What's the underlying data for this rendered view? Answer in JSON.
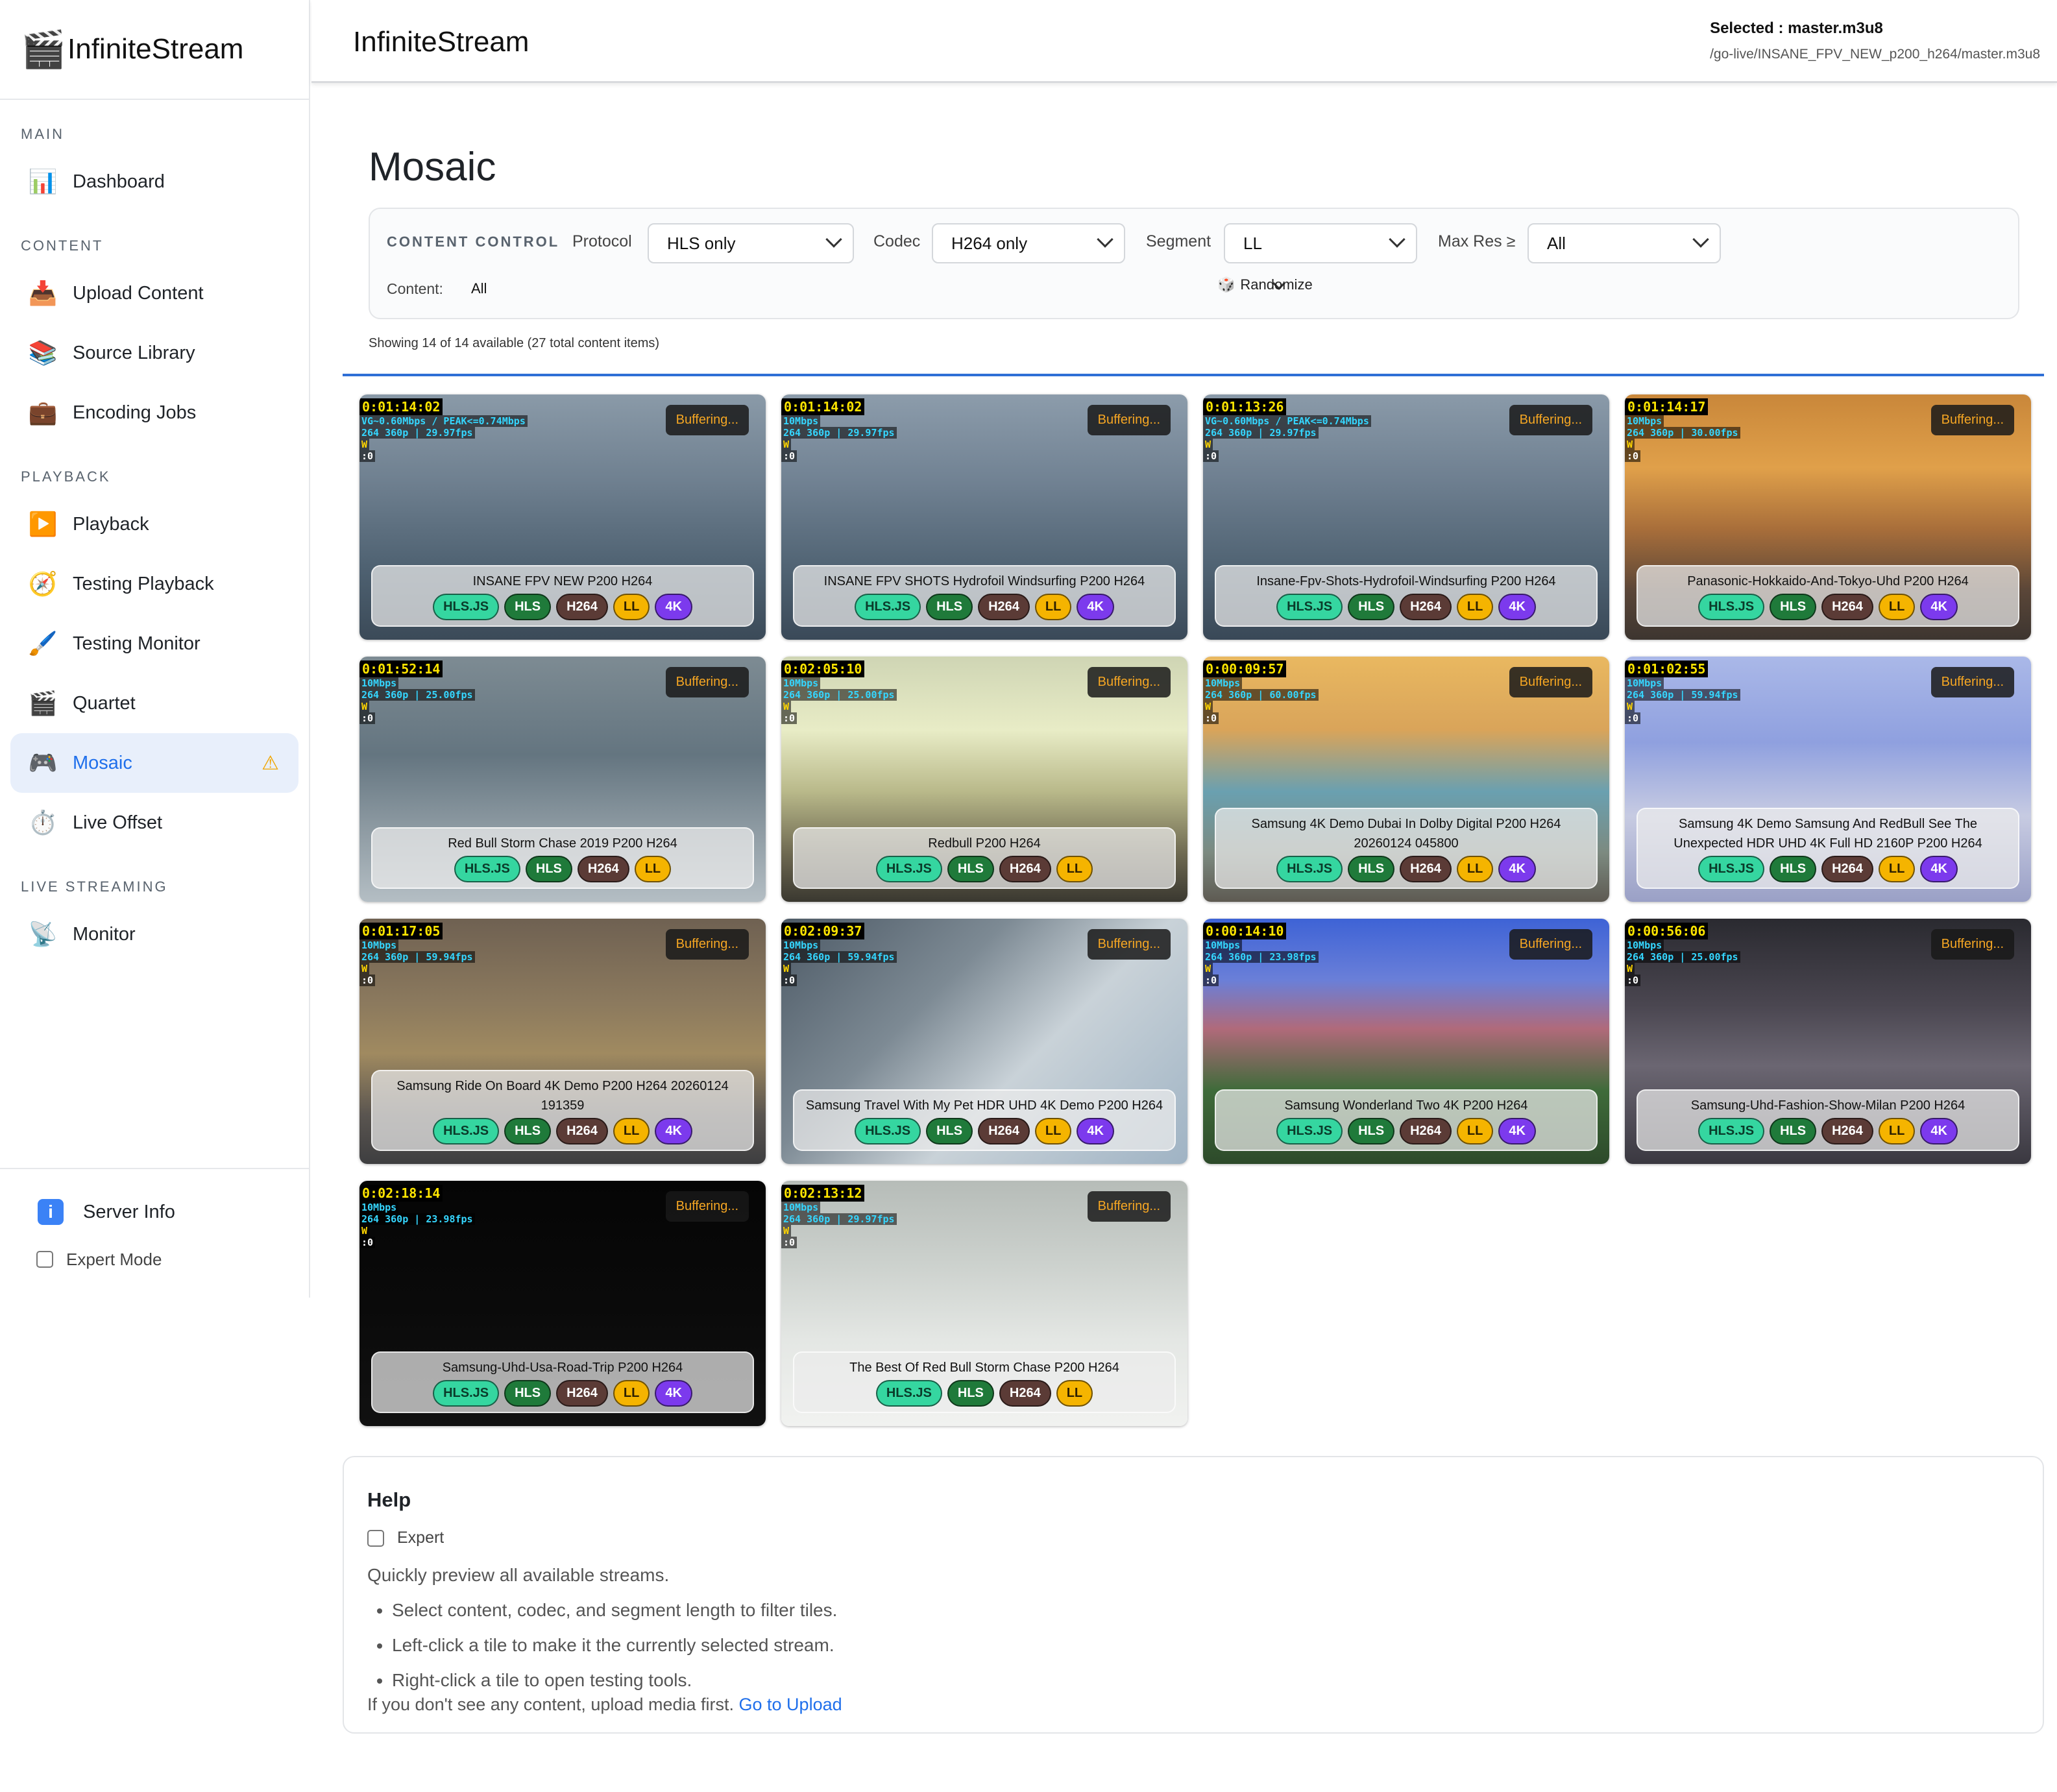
{
  "app": {
    "name": "InfiniteStream",
    "logo_icon": "clapperboard-icon"
  },
  "sidebar": {
    "sections": [
      {
        "label": "MAIN",
        "items": [
          {
            "label": "Dashboard",
            "icon": "bar-chart-icon"
          }
        ]
      },
      {
        "label": "CONTENT",
        "items": [
          {
            "label": "Upload Content",
            "icon": "upload-tray-icon"
          },
          {
            "label": "Source Library",
            "icon": "books-icon"
          },
          {
            "label": "Encoding Jobs",
            "icon": "briefcase-icon"
          }
        ]
      },
      {
        "label": "PLAYBACK",
        "items": [
          {
            "label": "Playback",
            "icon": "play-button-icon"
          },
          {
            "label": "Testing Playback",
            "icon": "compass-icon"
          },
          {
            "label": "Testing Monitor",
            "icon": "brush-icon"
          },
          {
            "label": "Quartet",
            "icon": "clapperboard-icon"
          },
          {
            "label": "Mosaic",
            "icon": "game-controller-icon",
            "active": true,
            "warning": "⚠"
          },
          {
            "label": "Live Offset",
            "icon": "stopwatch-icon"
          }
        ]
      },
      {
        "label": "LIVE STREAMING",
        "items": [
          {
            "label": "Monitor",
            "icon": "satellite-icon"
          }
        ]
      }
    ],
    "server_info": "Server Info",
    "expert_mode": "Expert Mode"
  },
  "header": {
    "title": "InfiniteStream",
    "selected_label": "Selected : master.m3u8",
    "selected_path": "/go-live/INSANE_FPV_NEW_p200_h264/master.m3u8"
  },
  "main": {
    "title": "Mosaic",
    "controls": {
      "section_label": "CONTENT CONTROL",
      "protocol_label": "Protocol",
      "protocol_value": "HLS only",
      "codec_label": "Codec",
      "codec_value": "H264 only",
      "segment_label": "Segment",
      "segment_value": "LL",
      "maxres_label": "Max Res ≥",
      "maxres_value": "All",
      "content_label": "Content:",
      "content_value": "All",
      "randomize_label": "Randomize"
    },
    "showing": "Showing 14 of 14 available (27 total content items)",
    "buffering_label": "Buffering...",
    "tiles": [
      {
        "name": "INSANE FPV NEW P200 H264",
        "timecode": "0:01:14:02",
        "line1": "VG~0.60Mbps / PEAK<=0.74Mbps",
        "line2": "264 360p | 29.97fps",
        "badges": [
          "HLS.JS",
          "HLS",
          "H264",
          "LL",
          "4K"
        ],
        "bg": "linear-gradient(180deg,#8a9aa8 0%,#6f8090 35%,#4f6272 70%,#3b4a58 100%)"
      },
      {
        "name": "INSANE FPV SHOTS Hydrofoil Windsurfing P200 H264",
        "timecode": "0:01:14:02",
        "line1": "10Mbps",
        "line2": "264 360p | 29.97fps",
        "badges": [
          "HLS.JS",
          "HLS",
          "H264",
          "LL",
          "4K"
        ],
        "bg": "linear-gradient(180deg,#8c9cab 0%,#718293 35%,#516474 70%,#3a4958 100%)"
      },
      {
        "name": "Insane-Fpv-Shots-Hydrofoil-Windsurfing P200 H264",
        "timecode": "0:01:13:26",
        "line1": "VG~0.60Mbps / PEAK<=0.74Mbps",
        "line2": "264 360p | 29.97fps",
        "badges": [
          "HLS.JS",
          "HLS",
          "H264",
          "LL",
          "4K"
        ],
        "bg": "linear-gradient(180deg,#8a9aa9 0%,#6e7f90 35%,#506373 70%,#394857 100%)"
      },
      {
        "name": "Panasonic-Hokkaido-And-Tokyo-Uhd P200 H264",
        "timecode": "0:01:14:17",
        "line1": "10Mbps",
        "line2": "264 360p | 30.00fps",
        "badges": [
          "HLS.JS",
          "HLS",
          "H264",
          "LL",
          "4K"
        ],
        "bg": "linear-gradient(180deg,#c9873a 0%,#e0a04a 30%,#a86e3a 55%,#5a4638 80%,#3d3530 100%)"
      },
      {
        "name": "Red Bull Storm Chase 2019 P200 H264",
        "timecode": "0:01:52:14",
        "line1": "10Mbps",
        "line2": "264 360p | 25.00fps",
        "badges": [
          "HLS.JS",
          "HLS",
          "H264",
          "LL"
        ],
        "bg": "linear-gradient(180deg,#7d8b93 0%,#647580 40%,#8d9aa2 70%,#b4bec4 100%)"
      },
      {
        "name": "Redbull P200 H264",
        "timecode": "0:02:05:10",
        "line1": "10Mbps",
        "line2": "264 360p | 25.00fps",
        "badges": [
          "HLS.JS",
          "HLS",
          "H264",
          "LL"
        ],
        "bg": "linear-gradient(180deg,#cfd5b4 0%,#e8ecc6 30%,#b9b98a 55%,#6f6a52 80%,#3a3830 100%)"
      },
      {
        "name": "Samsung 4K Demo Dubai In Dolby Digital P200 H264 20260124 045800",
        "timecode": "0:00:09:57",
        "line1": "10Mbps",
        "line2": "264 360p | 60.00fps",
        "badges": [
          "HLS.JS",
          "HLS",
          "H264",
          "LL",
          "4K"
        ],
        "bg": "linear-gradient(180deg,#e9b860 0%,#d9a45a 30%,#6aa0b0 55%,#7c8a80 80%,#5e5a52 100%)"
      },
      {
        "name": "Samsung 4K Demo Samsung And RedBull See The Unexpected HDR UHD 4K Full HD 2160P P200 H264",
        "timecode": "0:01:02:55",
        "line1": "10Mbps",
        "line2": "264 360p | 59.94fps",
        "badges": [
          "HLS.JS",
          "HLS",
          "H264",
          "LL",
          "4K"
        ],
        "bg": "linear-gradient(180deg,#aab8e8 0%,#8fa0df 35%,#c7cbe2 65%,#9aa0c6 100%)"
      },
      {
        "name": "Samsung Ride On Board 4K Demo P200 H264 20260124 191359",
        "timecode": "0:01:17:05",
        "line1": "10Mbps",
        "line2": "264 360p | 59.94fps",
        "badges": [
          "HLS.JS",
          "HLS",
          "H264",
          "LL",
          "4K"
        ],
        "bg": "linear-gradient(180deg,#6f6152 0%,#8c7a5e 35%,#a08a60 55%,#5a5550 80%,#3e3e40 100%)"
      },
      {
        "name": "Samsung Travel With My Pet HDR UHD 4K Demo P200 H264",
        "timecode": "0:02:09:37",
        "line1": "10Mbps",
        "line2": "264 360p | 59.94fps",
        "badges": [
          "HLS.JS",
          "HLS",
          "H264",
          "LL",
          "4K"
        ],
        "bg": "linear-gradient(135deg,#4d5a66 0%,#7d8a94 35%,#c9d2d8 60%,#9fb3c4 100%)"
      },
      {
        "name": "Samsung Wonderland Two 4K P200 H264",
        "timecode": "0:00:14:10",
        "line1": "10Mbps",
        "line2": "264 360p | 23.98fps",
        "badges": [
          "HLS.JS",
          "HLS",
          "H264",
          "LL",
          "4K"
        ],
        "bg": "linear-gradient(180deg,#3e63d6 0%,#6a7fd8 25%,#b06a7a 45%,#3f6b3a 70%,#2d4a2a 100%)"
      },
      {
        "name": "Samsung-Uhd-Fashion-Show-Milan P200 H264",
        "timecode": "0:00:56:06",
        "line1": "10Mbps",
        "line2": "264 360p | 25.00fps",
        "badges": [
          "HLS.JS",
          "HLS",
          "H264",
          "LL",
          "4K"
        ],
        "bg": "linear-gradient(180deg,#2a2a30 0%,#4a4650 35%,#6b6672 60%,#3a3840 100%)"
      },
      {
        "name": "Samsung-Uhd-Usa-Road-Trip P200 H264",
        "timecode": "0:02:18:14",
        "line1": "10Mbps",
        "line2": "264 360p | 23.98fps",
        "badges": [
          "HLS.JS",
          "HLS",
          "H264",
          "LL",
          "4K"
        ],
        "bg": "linear-gradient(180deg,#050505 0%,#0a0a0a 50%,#111111 100%)"
      },
      {
        "name": "The Best Of Red Bull Storm Chase P200 H264",
        "timecode": "0:02:13:12",
        "line1": "10Mbps",
        "line2": "264 360p | 29.97fps",
        "badges": [
          "HLS.JS",
          "HLS",
          "H264",
          "LL"
        ],
        "bg": "linear-gradient(180deg,#b6bcb8 0%,#cdd2ce 35%,#e4e7e4 65%,#f1f2f0 100%)"
      }
    ]
  },
  "help": {
    "title": "Help",
    "expert_label": "Expert",
    "intro": "Quickly preview all available streams.",
    "bullets": [
      "Select content, codec, and segment length to filter tiles.",
      "Left-click a tile to make it the currently selected stream.",
      "Right-click a tile to open testing tools."
    ],
    "footer_text": "If you don't see any content, upload media first.",
    "footer_link": "Go to Upload"
  },
  "colors": {
    "accent": "#1f6feb",
    "buffering": "#f5a623",
    "divider": "#2f6fd6"
  }
}
